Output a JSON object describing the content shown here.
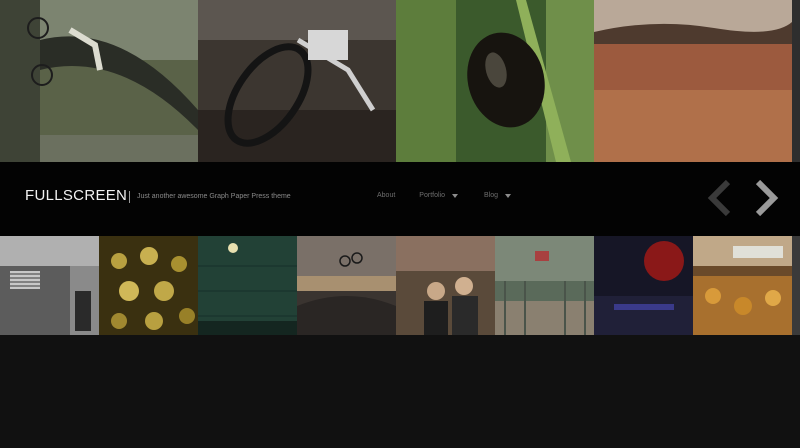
{
  "site": {
    "title": "FULLSCREEN",
    "tagline": "Just another awesome Graph Paper Press theme"
  },
  "nav": {
    "items": [
      {
        "label": "About",
        "has_dropdown": false
      },
      {
        "label": "Portfolio",
        "has_dropdown": true
      },
      {
        "label": "Blog",
        "has_dropdown": true
      }
    ]
  },
  "slider": {
    "prev_icon": "chevron-left-icon",
    "next_icon": "chevron-right-icon"
  },
  "colors": {
    "background": "#111111",
    "header_band": "#030303",
    "title": "#f2f2f2",
    "tagline": "#8a8a8a",
    "nav_text": "#6e6e6e"
  }
}
